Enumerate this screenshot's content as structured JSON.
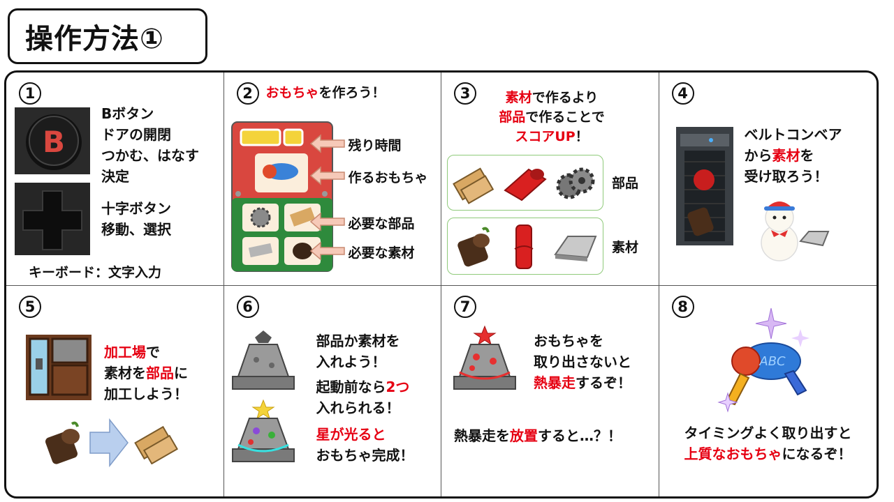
{
  "title": "操作方法①",
  "cells": {
    "c1": {
      "num": "1",
      "b_lines": [
        "Bボタン",
        "ドアの開閉",
        "つかむ、はなす",
        "決定"
      ],
      "b_button_letter": "B",
      "dpad_lines": [
        "十字ボタン",
        "移動、選択"
      ],
      "keyboard": "キーボード：文字入力"
    },
    "c2": {
      "num": "2",
      "heading_red": "おもちゃ",
      "heading_rest": "を作ろう！",
      "labels": [
        "残り時間",
        "作るおもちゃ",
        "必要な部品",
        "必要な素材"
      ]
    },
    "c3": {
      "num": "3",
      "line1_red": "素材",
      "line1_rest": "で作るより",
      "line2_red": "部品",
      "line2_rest": "で作ることで",
      "line3_red": "スコアUP",
      "line3_rest": "！",
      "parts_label": "部品",
      "materials_label": "素材"
    },
    "c4": {
      "num": "4",
      "line1": "ベルトコンベア",
      "line2_pre": "から",
      "line2_red": "素材",
      "line2_post": "を",
      "line3": "受け取ろう！"
    },
    "c5": {
      "num": "5",
      "line1_red": "加工場",
      "line1_rest": "で",
      "line2_pre": "素材を",
      "line2_red": "部品",
      "line2_post": "に",
      "line3": "加工しよう！"
    },
    "c6": {
      "num": "6",
      "a_line1": "部品か素材を",
      "a_line2": "入れよう！",
      "b_line1_pre": "起動前なら",
      "b_line1_red": "2つ",
      "b_line2": "入れられる！",
      "c_line1_red": "星が光ると",
      "c_line2": "おもちゃ完成！"
    },
    "c7": {
      "num": "7",
      "line1": "おもちゃを",
      "line2": "取り出さないと",
      "line3_red": "熱暴走",
      "line3_rest": "するぞ！",
      "line4_pre": "熱暴走を",
      "line4_red": "放置",
      "line4_post": "すると…？！"
    },
    "c8": {
      "num": "8",
      "line1": "タイミングよく取り出すと",
      "line2_red": "上質なおもちゃ",
      "line2_rest": "になるぞ！",
      "toy_text": "ABC"
    }
  },
  "colors": {
    "accent_red": "#e60012",
    "green_border": "#8fca7a",
    "panel_red": "#d9473f",
    "panel_green": "#2e8a3c",
    "pale_arrow": "#f6c9b8"
  }
}
